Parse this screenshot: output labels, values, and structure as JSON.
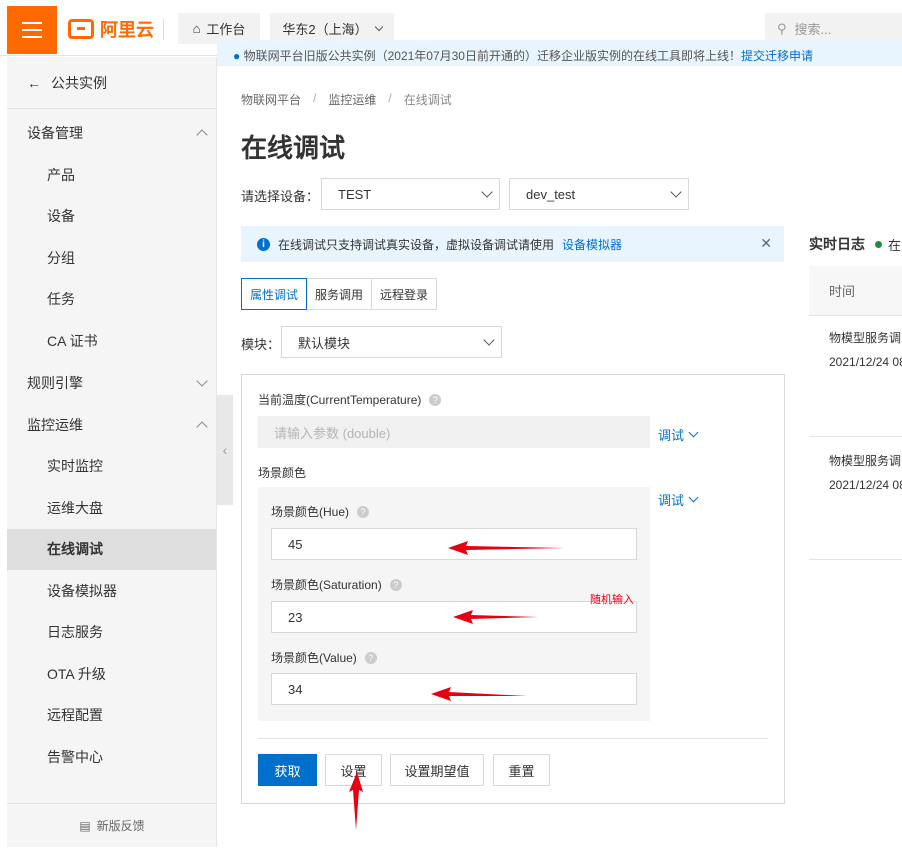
{
  "topbar": {
    "brand": "阿里云",
    "workbench": "工作台",
    "region": "华东2（上海）",
    "search_placeholder": "搜索..."
  },
  "notice": {
    "text": "物联网平台旧版公共实例（2021年07月30日前开通的）迁移企业版实例的在线工具即将上线！",
    "link": "提交迁移申请"
  },
  "sidebar": {
    "back": "公共实例",
    "groups": [
      {
        "label": "设备管理",
        "items": [
          "产品",
          "设备",
          "分组",
          "任务",
          "CA 证书"
        ]
      },
      {
        "label": "规则引擎"
      },
      {
        "label": "监控运维",
        "items": [
          "实时监控",
          "运维大盘",
          "在线调试",
          "设备模拟器",
          "日志服务",
          "OTA 升级",
          "远程配置",
          "告警中心"
        ]
      }
    ],
    "feedback": "新版反馈"
  },
  "breadcrumb": [
    "物联网平台",
    "监控运维",
    "在线调试"
  ],
  "page_title": "在线调试",
  "device_select": {
    "label": "请选择设备：",
    "product": "TEST",
    "device": "dev_test"
  },
  "info_bar": {
    "text": "在线调试只支持调试真实设备，虚拟设备调试请使用",
    "link": "设备模拟器"
  },
  "tabs": [
    "属性调试",
    "服务调用",
    "远程登录"
  ],
  "module": {
    "label": "模块：",
    "value": "默认模块"
  },
  "properties": {
    "current_temperature": {
      "label": "当前温度(CurrentTemperature)",
      "placeholder": "请输入参数 (double)",
      "debug": "调试"
    },
    "scene_color": {
      "label": "场景颜色",
      "debug": "调试",
      "hue_label": "场景颜色(Hue)",
      "hue_value": "45",
      "saturation_label": "场景颜色(Saturation)",
      "saturation_value": "23",
      "value_label": "场景颜色(Value)",
      "value_value": "34"
    }
  },
  "annotation": "随机输入",
  "buttons": {
    "get": "获取",
    "set": "设置",
    "set_expected": "设置期望值",
    "reset": "重置"
  },
  "log": {
    "title": "实时日志",
    "status": "在",
    "column_time": "时间",
    "entries": [
      {
        "type": "物模型服务调",
        "time": "2021/12/24 08"
      },
      {
        "type": "物模型服务调",
        "time": "2021/12/24 08"
      }
    ]
  },
  "colors": {
    "brand": "#ff6a00",
    "primary": "#0070cc",
    "annotation_red": "#e60012"
  }
}
